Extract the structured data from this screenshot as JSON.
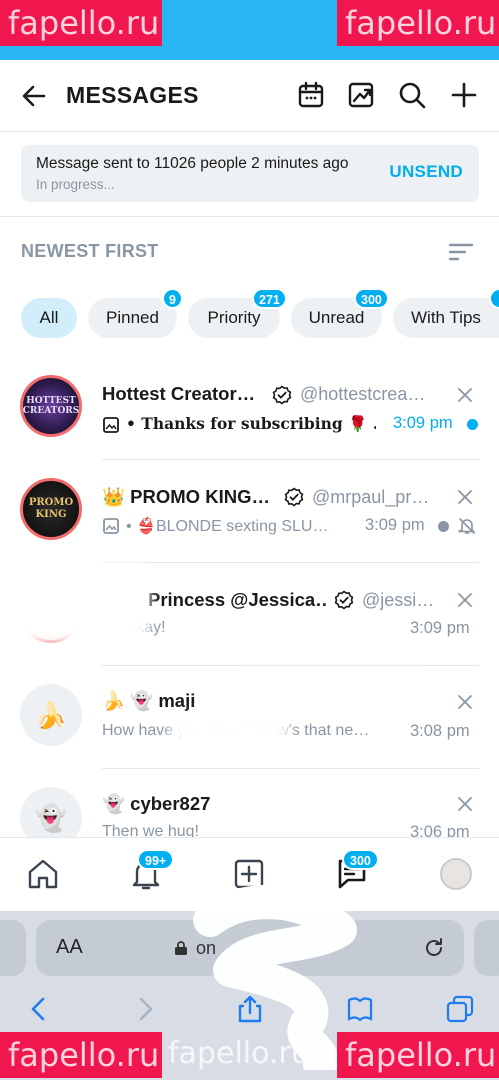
{
  "watermark": "fapello.ru",
  "watermark_bottom_text": "fapello.ru...c m/Cinc",
  "header": {
    "title": "MESSAGES"
  },
  "banner": {
    "message": "Message sent to 11026 people 2 minutes ago",
    "status": "In progress...",
    "action": "UNSEND"
  },
  "sort": {
    "label": "NEWEST FIRST"
  },
  "filters": [
    {
      "label": "All",
      "badge": ""
    },
    {
      "label": "Pinned",
      "badge": "9"
    },
    {
      "label": "Priority",
      "badge": "271"
    },
    {
      "label": "Unread",
      "badge": "300"
    },
    {
      "label": "With Tips",
      "badge": ""
    }
  ],
  "chats": [
    {
      "name": "Hottest Creator…",
      "handle": "@hottestcrea…",
      "preview": "• Thanks for subscribing 🌹 …",
      "time": "3:09 pm",
      "avatar_text": "HOTTEST CREATORS"
    },
    {
      "name": "👑 PROMO KING…",
      "handle": "@mrpaul_pr…",
      "preview": "• 👙BLONDE sexting SLU…",
      "time": "3:09 pm",
      "avatar_text": "PROMO KING"
    },
    {
      "name": "Princess @Jessica…",
      "handle": "@jessi…",
      "preview": "I'm okay!",
      "time": "3:09 pm"
    },
    {
      "name": "🍌 👻 maji",
      "handle": "",
      "preview": "How have you been? How's that ne…",
      "time": "3:08 pm",
      "avatar_emoji": "🍌"
    },
    {
      "name": "👻 cyber827",
      "handle": "",
      "preview": "Then we hug!",
      "time": "3:06 pm",
      "avatar_emoji": "👻"
    }
  ],
  "tabbar": {
    "notifications_badge": "99+",
    "messages_badge": "300"
  },
  "browser": {
    "aa": "AA",
    "url": "on"
  },
  "colors": {
    "accent": "#00aff0",
    "status_bar": "#29b6f6",
    "watermark": "#f0164e"
  }
}
